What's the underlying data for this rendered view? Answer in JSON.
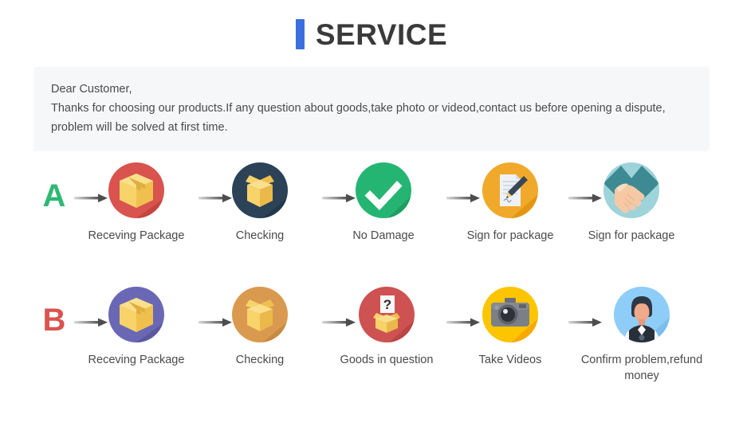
{
  "header": {
    "title": "SERVICE",
    "accent_color": "#3b6fe0"
  },
  "notice": {
    "greeting": "Dear Customer,",
    "line2": "Thanks for choosing our products.If any question about goods,take photo or videod,contact us before opening a dispute,",
    "line3": "problem will be solved at first time.",
    "background": "#f6f7f9"
  },
  "flows": [
    {
      "badge": "A",
      "badge_color": "#2eb873",
      "steps": [
        {
          "label": "Receving Package",
          "icon": "package-box-icon",
          "circle_color": "#d9534f"
        },
        {
          "label": "Checking",
          "icon": "open-box-icon",
          "circle_color": "#2b4257"
        },
        {
          "label": "No Damage",
          "icon": "check-mark-icon",
          "circle_color": "#25b573"
        },
        {
          "label": "Sign for package",
          "icon": "document-pen-icon",
          "circle_color": "#f0a92b"
        },
        {
          "label": "Sign for package",
          "icon": "handshake-icon",
          "circle_color": "#9ed3da"
        }
      ]
    },
    {
      "badge": "B",
      "badge_color": "#d9534f",
      "steps": [
        {
          "label": "Receving Package",
          "icon": "package-box-icon",
          "circle_color": "#6a68b5"
        },
        {
          "label": "Checking",
          "icon": "open-box-icon",
          "circle_color": "#d99a50"
        },
        {
          "label": "Goods in question",
          "icon": "question-box-icon",
          "circle_color": "#ce5252"
        },
        {
          "label": "Take Videos",
          "icon": "camera-icon",
          "circle_color": "#fdc500"
        },
        {
          "label": "Confirm problem,refund money",
          "icon": "person-avatar-icon",
          "circle_color": "#8ecdf7"
        }
      ]
    }
  ],
  "arrow": {
    "name": "arrow-right-icon",
    "color_start": "#d6d6d6",
    "color_end": "#4a4a4a"
  }
}
